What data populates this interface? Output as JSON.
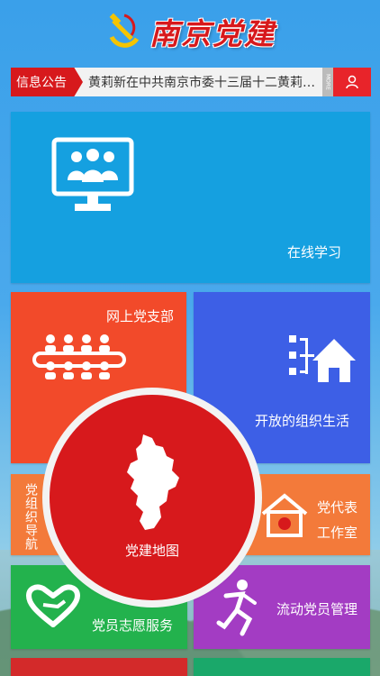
{
  "header": {
    "title": "南京党建",
    "emblem": "hammer-sickle-icon"
  },
  "notice": {
    "tag": "信息公告",
    "text": "黄莉新在中共南京市委十三届十二黄莉新在中共南京市委十三届十二",
    "strip": "MORE",
    "user_icon": "user-icon"
  },
  "tiles": {
    "study": {
      "label": "在线学习",
      "icon": "online-study-icon",
      "color": "#15a0e0"
    },
    "branch": {
      "label": "网上党支部",
      "icon": "group-meeting-icon",
      "color": "#f24a2a"
    },
    "org": {
      "label": "开放的组织生活",
      "icon": "org-house-icon",
      "color": "#3d5fe6"
    },
    "nav": {
      "label": "党组织导航",
      "color": "#f37a3a"
    },
    "map": {
      "label": "党建地图",
      "icon": "nanjing-map-icon",
      "color": "#d7191c"
    },
    "office": {
      "label_line1": "党代表",
      "label_line2": "工作室",
      "icon": "party-house-icon",
      "color": "#f37a3a"
    },
    "volunteer": {
      "label": "党员志愿服务",
      "icon": "heart-hand-icon",
      "color": "#23b24d"
    },
    "mobile": {
      "label": "流动党员管理",
      "icon": "running-person-icon",
      "color": "#a33cc3"
    }
  }
}
